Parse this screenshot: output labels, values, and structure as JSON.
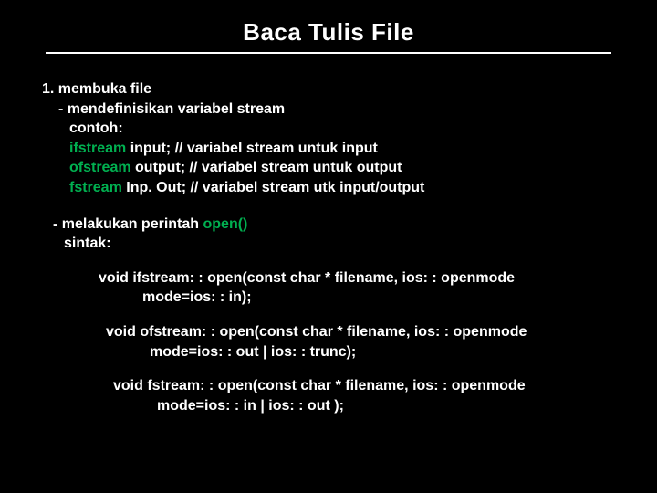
{
  "title": "Baca Tulis File",
  "section1": {
    "heading": "1. membuka file",
    "bullet1": "- mendefinisikan variabel stream",
    "contoh": "contoh:",
    "ex1_kw": "ifstream",
    "ex1_rest": " input;      // variabel stream untuk input",
    "ex2_kw": "ofstream",
    "ex2_rest": " output; // variabel stream untuk output",
    "ex3_kw": "fstream",
    "ex3_rest": " Inp. Out;   // variabel stream utk input/output"
  },
  "section2": {
    "bullet": "- melakukan perintah ",
    "open_kw": "open()",
    "sintak": "sintak:"
  },
  "sig1": {
    "line1": "void ifstream: : open(const char * filename, ios: : openmode",
    "line2": "mode=ios: : in);"
  },
  "sig2": {
    "line1": "void ofstream: : open(const char * filename, ios: : openmode",
    "line2": "mode=ios: : out | ios: : trunc);"
  },
  "sig3": {
    "line1": "void fstream: : open(const char * filename, ios: : openmode",
    "line2": "mode=ios: : in | ios: : out );"
  }
}
